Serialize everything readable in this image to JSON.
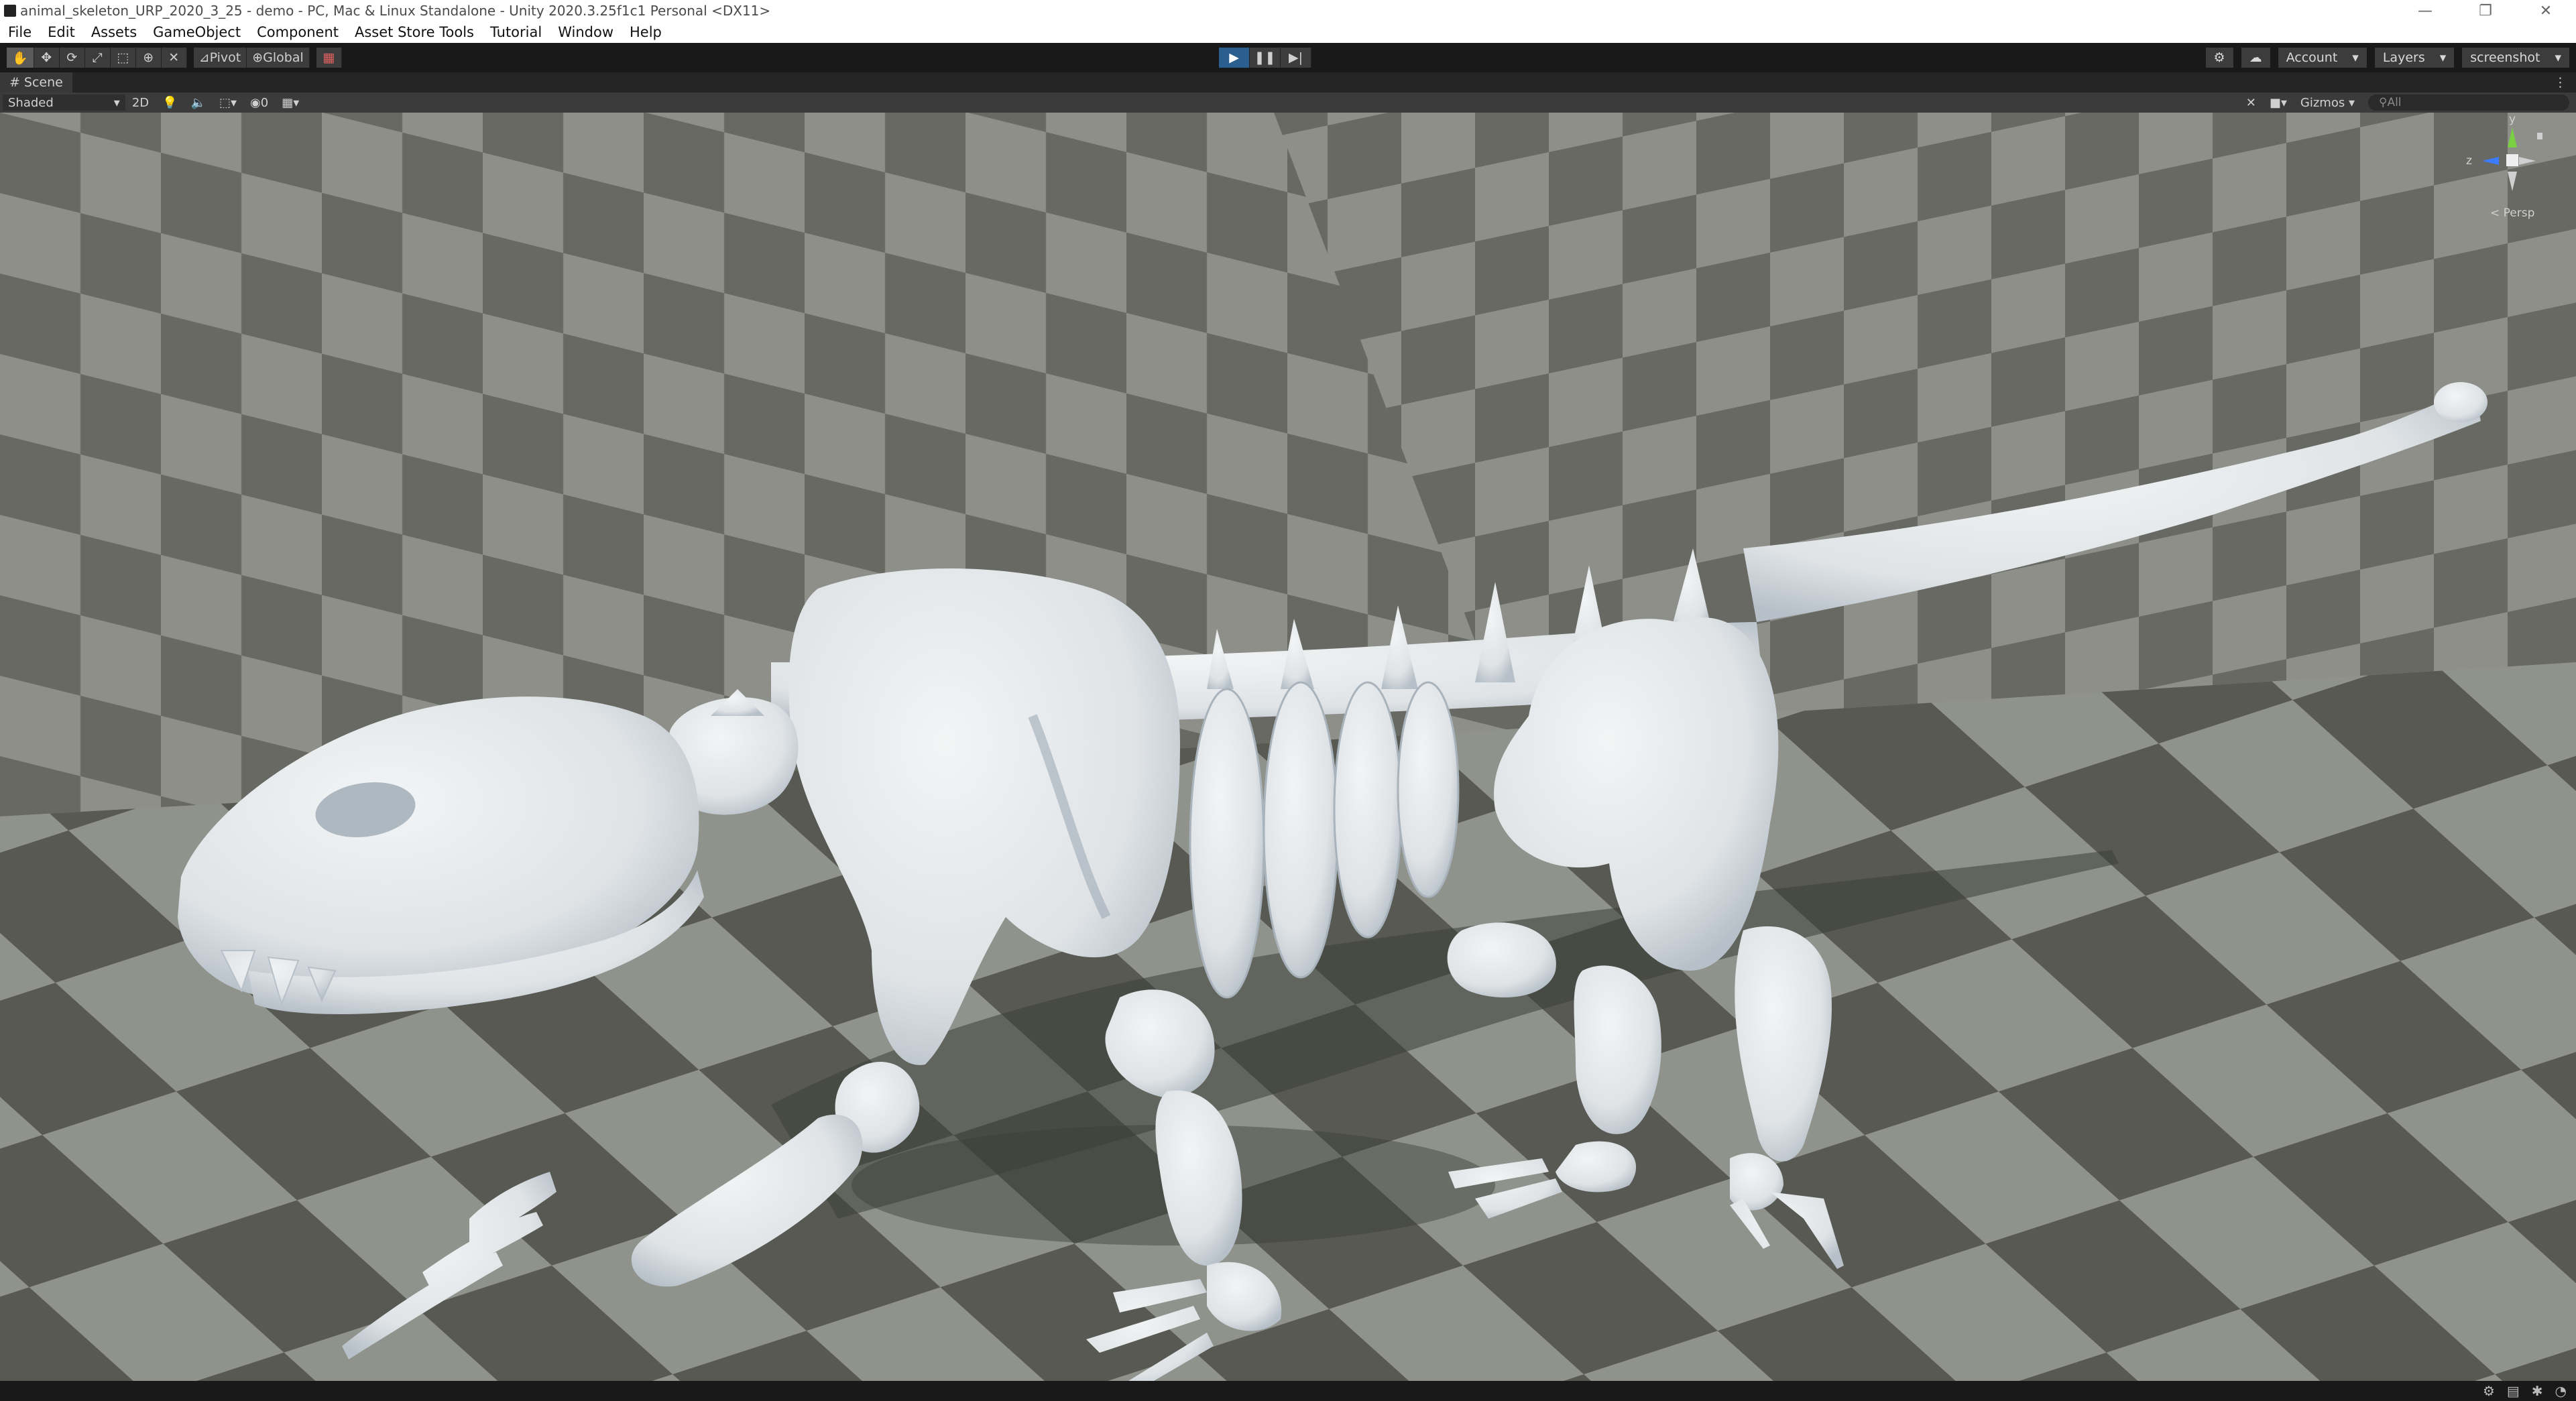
{
  "window": {
    "title": "animal_skeleton_URP_2020_3_25 - demo - PC, Mac & Linux Standalone - Unity 2020.3.25f1c1 Personal <DX11>",
    "controls": [
      "—",
      "❐",
      "✕"
    ]
  },
  "menu": [
    "File",
    "Edit",
    "Assets",
    "GameObject",
    "Component",
    "Asset Store Tools",
    "Tutorial",
    "Window",
    "Help"
  ],
  "toolbar": {
    "pivot_label": "Pivot",
    "global_label": "Global",
    "account_label": "Account",
    "layers_label": "Layers",
    "layout_label": "screenshot"
  },
  "scene": {
    "tab_label": "Scene",
    "draw_mode": "Shaded",
    "mode_2d": "2D",
    "hidden_count": "0",
    "gizmos_label": "Gizmos",
    "search_placeholder": "All",
    "projection_label": "< Persp",
    "axis_y": "y",
    "axis_z": "z"
  },
  "colors": {
    "toolbar_bg": "#191919",
    "play_active": "#2b5f8f",
    "floor_light": "#8f918a",
    "floor_dark": "#5d5f58",
    "bone": "#e6e9ea"
  }
}
